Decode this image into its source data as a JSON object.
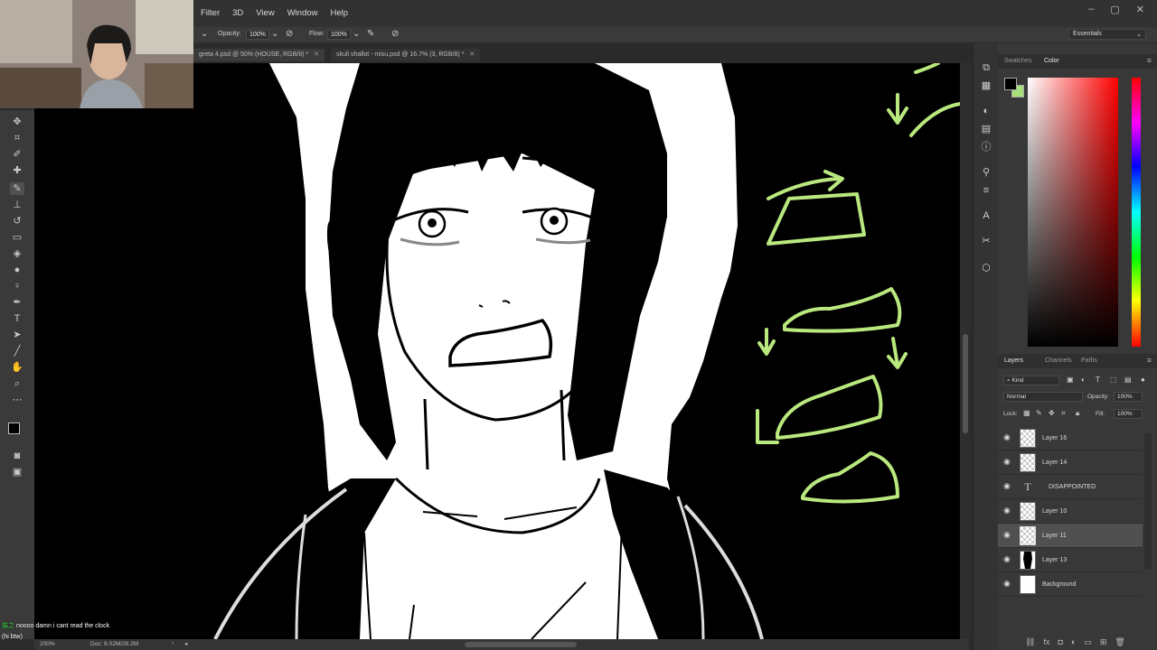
{
  "menu": [
    "Filter",
    "3D",
    "View",
    "Window",
    "Help"
  ],
  "window_controls": [
    "–",
    "▢",
    "✕"
  ],
  "options_bar": {
    "opacity_label": "Opacity:",
    "opacity_value": "100%",
    "flow_label": "Flow:",
    "flow_value": "100%",
    "workspace": "Essentials"
  },
  "tabs": [
    {
      "title": "greta 4.psd @ 50% (HOUSE, RGB/8) *",
      "close": "✕"
    },
    {
      "title": "skull shallot - misu.psd @ 16.7% (3, RGB/8) *",
      "close": "✕"
    }
  ],
  "status_bar": {
    "zoom": "200%",
    "doc_info": "Doc: 6.02M/26.2M"
  },
  "chat": [
    {
      "user": "猫之",
      "message": "noooo damn i cant read the clock"
    },
    {
      "user": "",
      "message": "(hi btw)"
    }
  ],
  "color_panel": {
    "tabs": [
      "Swatches",
      "Color"
    ],
    "active_tab": "Color",
    "foreground": "#000000",
    "background": "#a8e07a"
  },
  "layers_panel": {
    "tabs": [
      "Layers",
      "Channels",
      "Paths"
    ],
    "active_tab": "Layers",
    "filter_kind": "Kind",
    "blend_mode": "Normal",
    "opacity_label": "Opacity:",
    "opacity_value": "100%",
    "lock_label": "Lock:",
    "fill_label": "Fill:",
    "fill_value": "100%",
    "layers": [
      {
        "name": "Layer 16",
        "kind": "pixel",
        "visible": true,
        "selected": false
      },
      {
        "name": "Layer 14",
        "kind": "pixel",
        "visible": true,
        "selected": false
      },
      {
        "name": "DISAPPOINTED",
        "kind": "type",
        "visible": true,
        "selected": false
      },
      {
        "name": "Layer 10",
        "kind": "pixel",
        "visible": true,
        "selected": false
      },
      {
        "name": "Layer 11",
        "kind": "pixel",
        "visible": true,
        "selected": true
      },
      {
        "name": "Layer 13",
        "kind": "pixel",
        "visible": true,
        "selected": false
      },
      {
        "name": "Background",
        "kind": "pixel",
        "visible": true,
        "selected": false
      }
    ]
  },
  "colors": {
    "sketch_green": "#b9e87e"
  }
}
